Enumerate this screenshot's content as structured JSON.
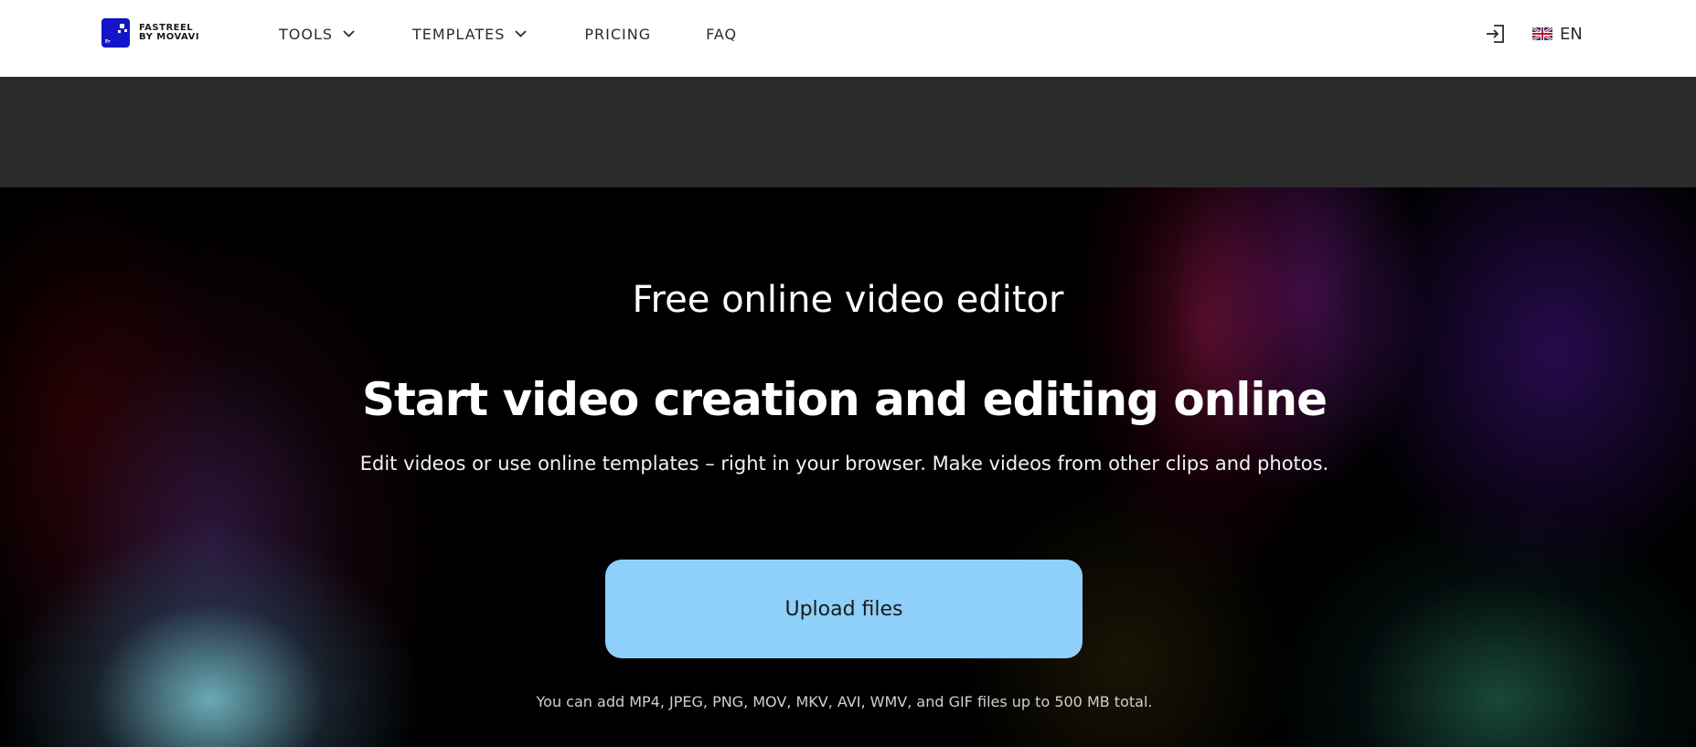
{
  "header": {
    "logo": {
      "line1": "FASTREEL",
      "line2": "BY MOVAVI",
      "mark_text": "Fr"
    },
    "nav": [
      {
        "label": "TOOLS",
        "has_dropdown": true
      },
      {
        "label": "TEMPLATES",
        "has_dropdown": true
      },
      {
        "label": "PRICING",
        "has_dropdown": false
      },
      {
        "label": "FAQ",
        "has_dropdown": false
      }
    ],
    "login_icon": "login-icon",
    "language": {
      "flag_icon": "uk-flag-icon",
      "code": "EN"
    }
  },
  "hero": {
    "subtitle": "Free online video editor",
    "title": "Start video creation and editing online",
    "description": "Edit videos or use online templates – right in your browser. Make videos from other clips and photos.",
    "upload_button": "Upload files",
    "note": "You can add MP4, JPEG, PNG, MOV, MKV, AVI, WMV, and GIF files up to 500 MB total."
  },
  "colors": {
    "header_bg": "#ffffff",
    "band_bg": "#2b2b2b",
    "hero_bg": "#000000",
    "upload_button_bg": "#8ed0fa",
    "brand_blue": "#1414c8"
  }
}
